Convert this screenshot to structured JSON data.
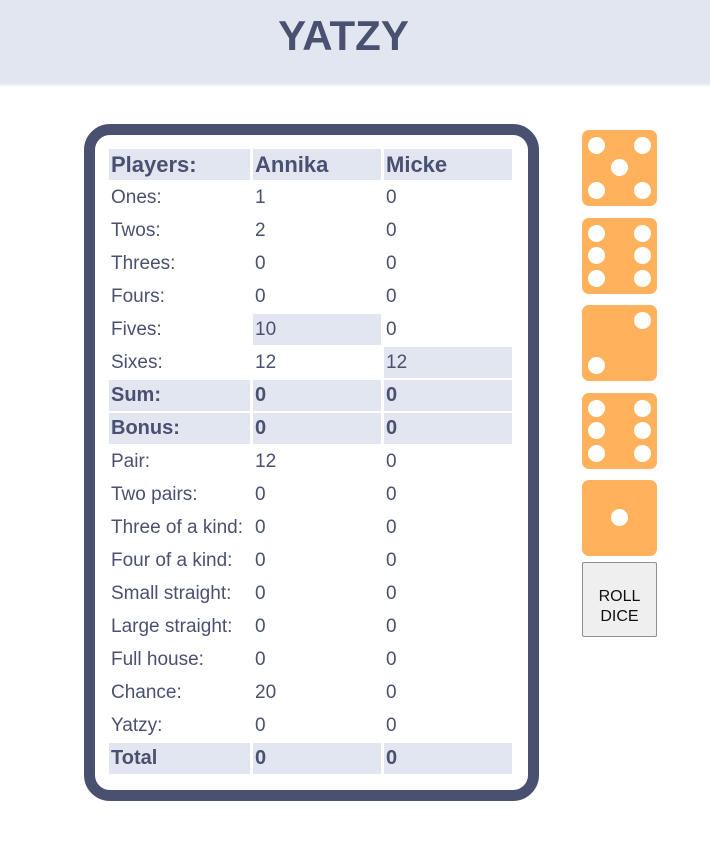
{
  "app": {
    "title": "YATZY"
  },
  "scoreboard": {
    "header": {
      "label": "Players:",
      "players": [
        "Annika",
        "Micke"
      ]
    },
    "rows": [
      {
        "label": "Ones:",
        "scores": [
          "1",
          "0"
        ]
      },
      {
        "label": "Twos:",
        "scores": [
          "2",
          "0"
        ]
      },
      {
        "label": "Threes:",
        "scores": [
          "0",
          "0"
        ]
      },
      {
        "label": "Fours:",
        "scores": [
          "0",
          "0"
        ]
      },
      {
        "label": "Fives:",
        "scores": [
          "10",
          "0"
        ]
      },
      {
        "label": "Sixes:",
        "scores": [
          "12",
          "12"
        ]
      },
      {
        "label": "Sum:",
        "scores": [
          "0",
          "0"
        ]
      },
      {
        "label": "Bonus:",
        "scores": [
          "0",
          "0"
        ]
      },
      {
        "label": "Pair:",
        "scores": [
          "12",
          "0"
        ]
      },
      {
        "label": "Two pairs:",
        "scores": [
          "0",
          "0"
        ]
      },
      {
        "label": "Three of a kind:",
        "scores": [
          "0",
          "0"
        ]
      },
      {
        "label": "Four of a kind:",
        "scores": [
          "0",
          "0"
        ]
      },
      {
        "label": "Small straight:",
        "scores": [
          "0",
          "0"
        ]
      },
      {
        "label": "Large straight:",
        "scores": [
          "0",
          "0"
        ]
      },
      {
        "label": "Full house:",
        "scores": [
          "0",
          "0"
        ]
      },
      {
        "label": "Chance:",
        "scores": [
          "20",
          "0"
        ]
      },
      {
        "label": "Yatzy:",
        "scores": [
          "0",
          "0"
        ]
      },
      {
        "label": "Total",
        "scores": [
          "0",
          "0"
        ]
      }
    ]
  },
  "dice": {
    "values": [
      5,
      6,
      2,
      6,
      1
    ],
    "colors": {
      "face": "#ffb15c",
      "pip": "#ffffff"
    }
  },
  "roll_button": {
    "line1": "ROLL",
    "line2": "DICE"
  },
  "colors": {
    "accent": "#4a5170",
    "highlight": "#e2e6f1"
  }
}
